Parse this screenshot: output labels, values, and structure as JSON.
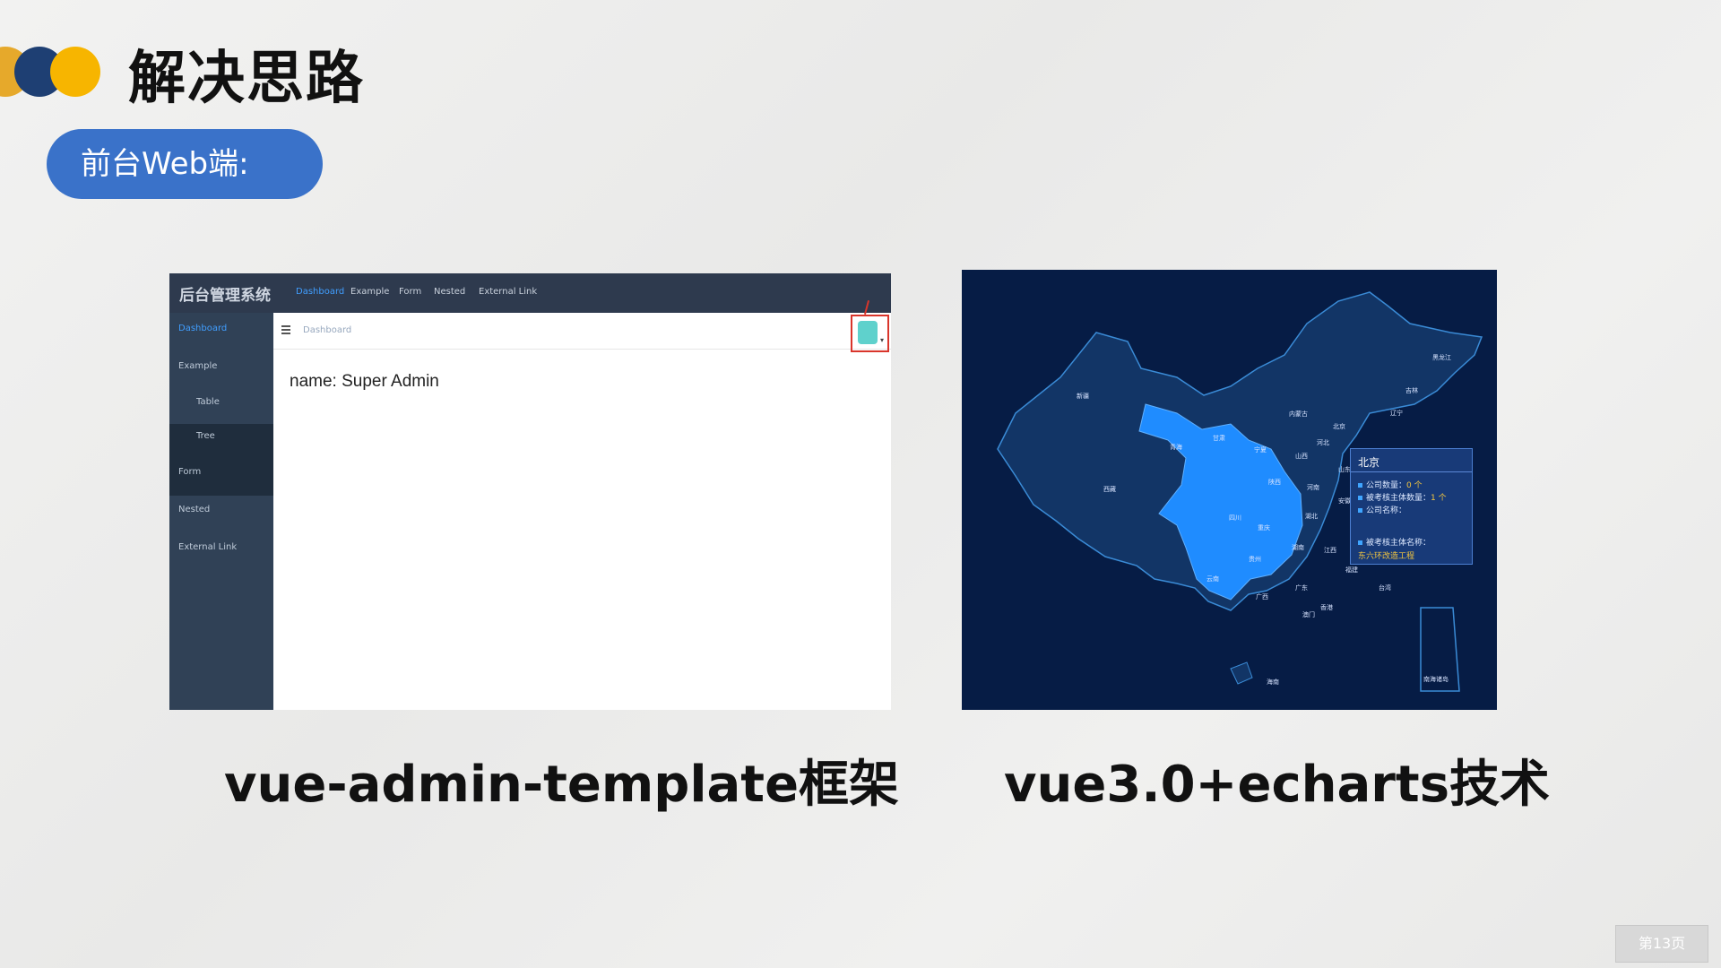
{
  "slide": {
    "title": "解决思路",
    "subtitle_pill": "前台Web端:",
    "page_label": "第13页",
    "accent_colors": [
      "#e6a92b",
      "#1e3f73",
      "#f7b500"
    ],
    "pill_color": "#3a72c9"
  },
  "admin_screenshot": {
    "brand": "后台管理系统",
    "nav": [
      "Dashboard",
      "Example",
      "Form",
      "Nested",
      "External Link"
    ],
    "sidebar": [
      "Dashboard",
      "Example",
      "Table",
      "Tree",
      "Form",
      "Nested",
      "External Link"
    ],
    "breadcrumb": "Dashboard",
    "content": "name: Super Admin"
  },
  "map_screenshot": {
    "provinces": [
      "新疆",
      "西藏",
      "青海",
      "甘肃",
      "内蒙古",
      "黑龙江",
      "吉林",
      "辽宁",
      "北京",
      "河北",
      "山西",
      "宁夏",
      "陕西",
      "河南",
      "山东",
      "四川",
      "重庆",
      "湖北",
      "安徽",
      "贵州",
      "湖南",
      "江西",
      "云南",
      "广西",
      "广东",
      "福建",
      "台湾",
      "香港",
      "澳门",
      "海南",
      "南海诸岛"
    ],
    "tooltip": {
      "title": "北京",
      "rows": [
        {
          "label": "公司数量：",
          "value": "0 个"
        },
        {
          "label": "被考核主体数量：",
          "value": "1 个"
        },
        {
          "label": "公司名称：",
          "value": ""
        },
        {
          "label": "被考核主体名称：",
          "value": ""
        }
      ],
      "link": "东六环改造工程"
    }
  },
  "captions": {
    "left": "vue-admin-template框架",
    "right": "vue3.0+echarts技术"
  }
}
